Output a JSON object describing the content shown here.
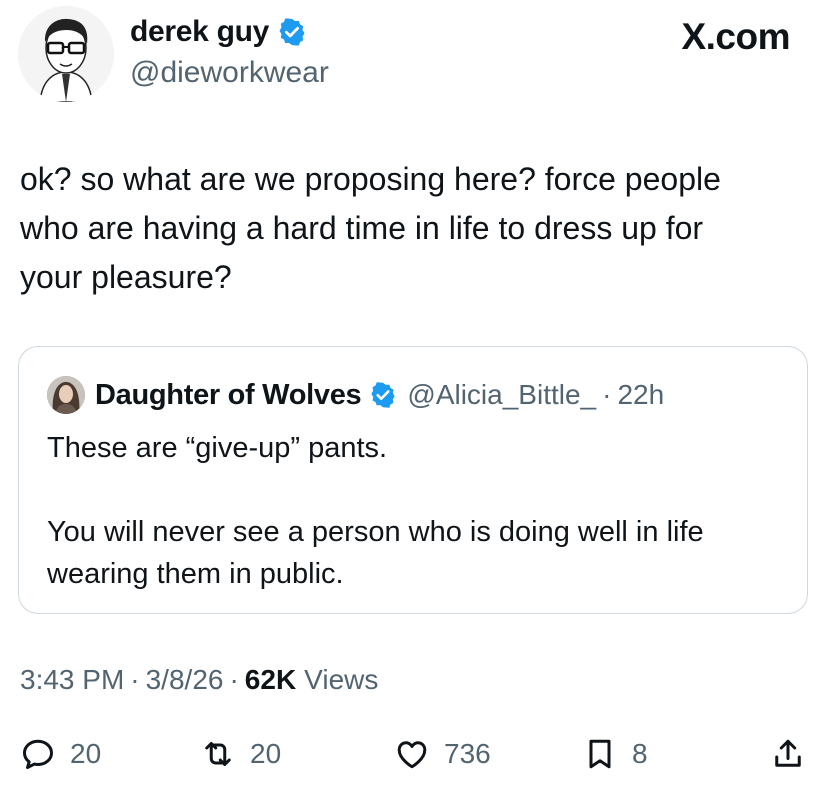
{
  "author": {
    "name": "derek guy",
    "handle": "@dieworkwear"
  },
  "brand": "X.com",
  "tweet": {
    "text": "ok? so what are we proposing here? force people\nwho are having a hard time in life to dress up for\nyour pleasure?"
  },
  "quote": {
    "name": "Daughter of Wolves",
    "handle": "@Alicia_Bittle_",
    "time": "22h",
    "text": "These are “give-up” pants.\n\nYou will never see a person who is doing well in life\nwearing them in public."
  },
  "meta": {
    "time": "3:43 PM",
    "date": "3/8/26",
    "views_count": "62K",
    "views_label": "Views",
    "separator": "·"
  },
  "actions": {
    "replies": "20",
    "reposts": "20",
    "likes": "736",
    "bookmarks": "8"
  },
  "colors": {
    "verified": "#1d9bf0",
    "secondary_text": "#536471",
    "border": "#cfd9de"
  }
}
